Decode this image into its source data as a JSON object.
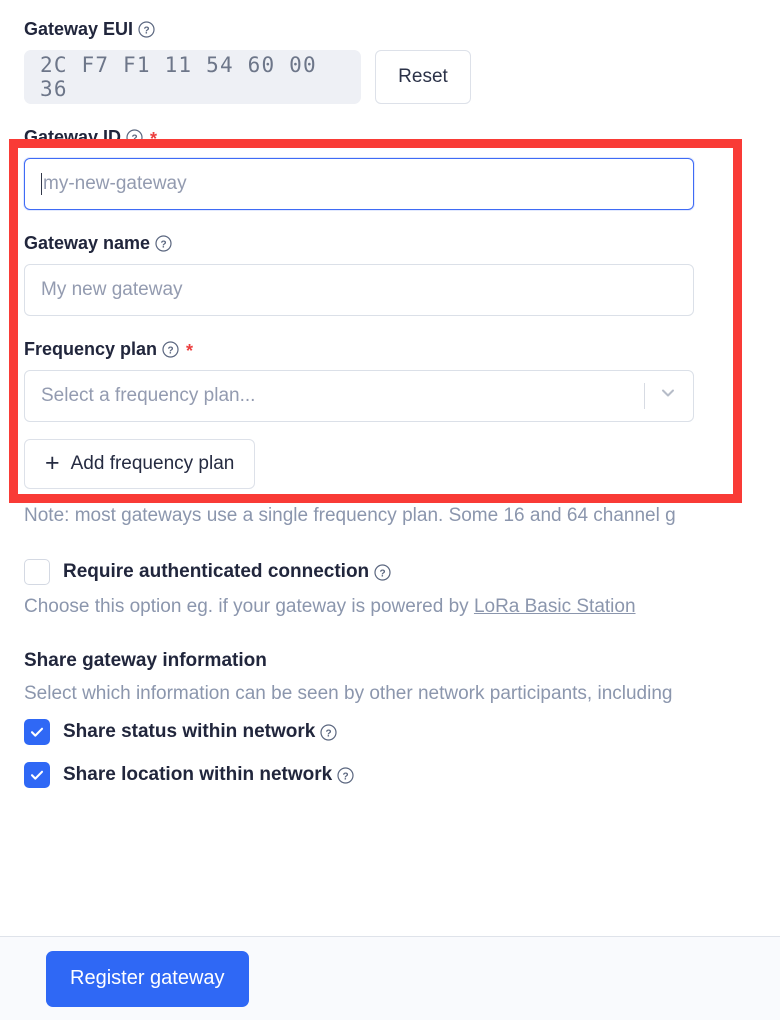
{
  "gateway_eui": {
    "label": "Gateway EUI",
    "help_icon": "question-circle-icon",
    "value": "2C F7 F1 11 54 60 00 36",
    "reset_label": "Reset"
  },
  "gateway_id": {
    "label": "Gateway ID",
    "help_icon": "question-circle-icon",
    "required_marker": "*",
    "value": "",
    "placeholder": "my-new-gateway"
  },
  "gateway_name": {
    "label": "Gateway name",
    "help_icon": "question-circle-icon",
    "value": "",
    "placeholder": "My new gateway"
  },
  "frequency_plan": {
    "label": "Frequency plan",
    "help_icon": "question-circle-icon",
    "required_marker": "*",
    "selected": "Select a frequency plan...",
    "chevron_icon": "chevron-down-icon",
    "add_button_label": "Add frequency plan",
    "add_button_icon": "plus-icon",
    "note": "Note: most gateways use a single frequency plan. Some 16 and 64 channel g"
  },
  "authenticated_connection": {
    "checkbox_label": "Require authenticated connection",
    "checked": false,
    "help_icon": "question-circle-icon",
    "description_before_link": "Choose this option eg. if your gateway is powered by ",
    "link_text": "LoRa Basic Station"
  },
  "share_section": {
    "title": "Share gateway information",
    "description": "Select which information can be seen by other network participants, including",
    "options": [
      {
        "label": "Share status within network",
        "checked": true,
        "help_icon": "question-circle-icon"
      },
      {
        "label": "Share location within network",
        "checked": true,
        "help_icon": "question-circle-icon"
      }
    ]
  },
  "footer": {
    "submit_label": "Register gateway"
  },
  "annotation": {
    "type": "red-highlight-rectangle",
    "color": "#f93b36"
  },
  "colors": {
    "accent_blue": "#2f68f5",
    "focus_blue": "#3f6bf5",
    "text_dark": "#21263c",
    "text_muted": "#8b96ad",
    "highlight_red": "#f93b36",
    "required_red": "#ec3f3f",
    "eui_background": "#eef0f5",
    "footer_background": "#f9fafd"
  }
}
